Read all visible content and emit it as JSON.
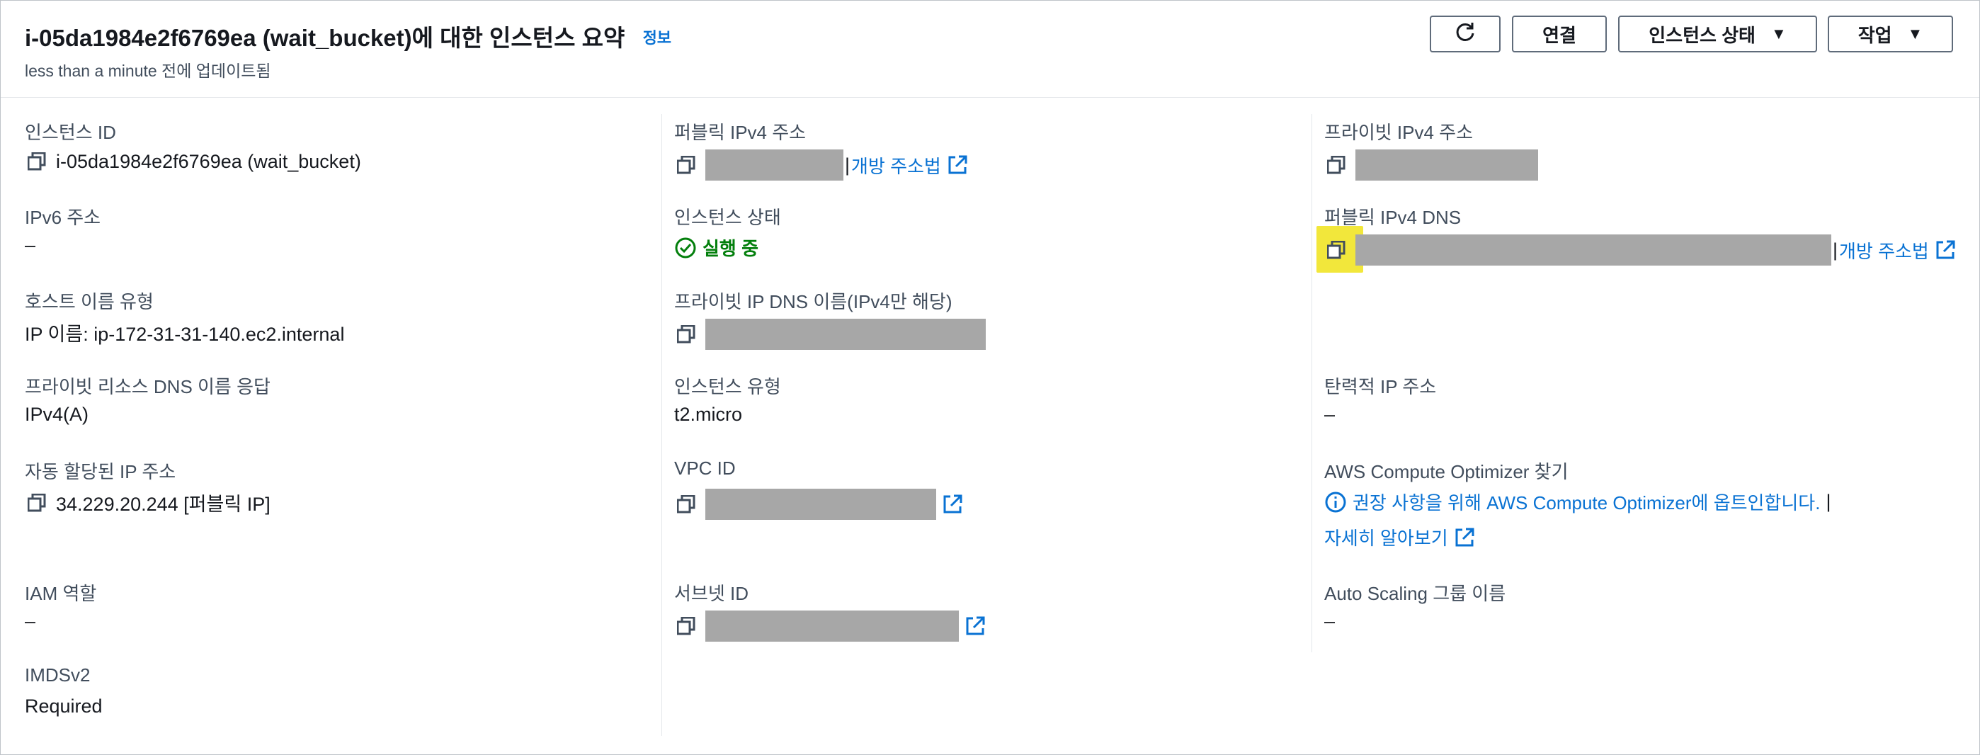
{
  "header": {
    "title": "i-05da1984e2f6769ea (wait_bucket)에 대한 인스턴스 요약",
    "info_link": "정보",
    "subtitle": "less than a minute 전에 업데이트됨",
    "buttons": {
      "refresh_icon": "refresh-icon",
      "connect": "연결",
      "instance_state": "인스턴스 상태",
      "actions": "작업"
    }
  },
  "col1": {
    "instance_id": {
      "label": "인스턴스 ID",
      "value": "i-05da1984e2f6769ea (wait_bucket)"
    },
    "ipv6": {
      "label": "IPv6 주소",
      "value": "–"
    },
    "hostname_type": {
      "label": "호스트 이름 유형",
      "value": "IP 이름: ip-172-31-31-140.ec2.internal"
    },
    "private_dns_answer": {
      "label": "프라이빗 리소스 DNS 이름 응답",
      "value": "IPv4(A)"
    },
    "auto_ip": {
      "label": "자동 할당된 IP 주소",
      "value": "34.229.20.244 [퍼블릭 IP]"
    },
    "iam_role": {
      "label": "IAM 역할",
      "value": "–"
    },
    "imdsv2": {
      "label": "IMDSv2",
      "value": "Required"
    }
  },
  "col2": {
    "public_ipv4": {
      "label": "퍼블릭 IPv4 주소",
      "link": "개방 주소법"
    },
    "instance_state": {
      "label": "인스턴스 상태",
      "value": "실행 중"
    },
    "private_ip_dns": {
      "label": "프라이빗 IP DNS 이름(IPv4만 해당)"
    },
    "instance_type": {
      "label": "인스턴스 유형",
      "value": "t2.micro"
    },
    "vpc_id": {
      "label": "VPC ID"
    },
    "subnet_id": {
      "label": "서브넷 ID"
    }
  },
  "col3": {
    "private_ipv4": {
      "label": "프라이빗 IPv4 주소"
    },
    "public_ipv4_dns": {
      "label": "퍼블릭 IPv4 DNS",
      "link": "개방 주소법"
    },
    "elastic_ip": {
      "label": "탄력적 IP 주소",
      "value": "–"
    },
    "optimizer": {
      "label": "AWS Compute Optimizer 찾기",
      "message": "권장 사항을 위해 AWS Compute Optimizer에 옵트인합니다.",
      "learn_more": "자세히 알아보기"
    },
    "asg": {
      "label": "Auto Scaling 그룹 이름",
      "value": "–"
    }
  },
  "colors": {
    "link": "#0972d3",
    "success": "#037f0c",
    "redaction": "#a7a7a7",
    "highlight": "#f2e73b"
  }
}
